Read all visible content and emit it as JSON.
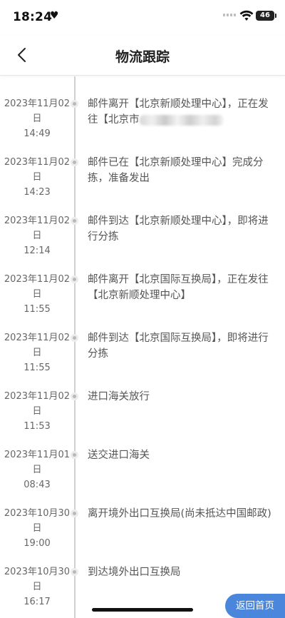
{
  "status_bar": {
    "time": "18:24",
    "heart_icon": "♥",
    "battery_level": "46",
    "signal_bars": 4,
    "signal_active_bars": 0
  },
  "nav": {
    "title": "物流跟踪",
    "back_icon": "chevron-left-icon"
  },
  "events": [
    {
      "date": "2023年11月02日",
      "time": "14:49",
      "desc_before_mask": "邮件离开【北京新顺处理中心】，正在发往【北京市",
      "has_mask": true
    },
    {
      "date": "2023年11月02日",
      "time": "14:23",
      "desc": "邮件已在【北京新顺处理中心】完成分拣，准备发出"
    },
    {
      "date": "2023年11月02日",
      "time": "12:14",
      "desc": "邮件到达【北京新顺处理中心】，即将进行分拣"
    },
    {
      "date": "2023年11月02日",
      "time": "11:55",
      "desc": "邮件离开【北京国际互换局】，正在发往【北京新顺处理中心】"
    },
    {
      "date": "2023年11月02日",
      "time": "11:55",
      "desc": "邮件到达【北京国际互换局】，即将进行分拣"
    },
    {
      "date": "2023年11月02日",
      "time": "11:53",
      "desc": "进口海关放行"
    },
    {
      "date": "2023年11月01日",
      "time": "08:43",
      "desc": "送交进口海关"
    },
    {
      "date": "2023年10月30日",
      "time": "19:00",
      "desc": "离开境外出口互换局(尚未抵达中国邮政)"
    },
    {
      "date": "2023年10月30日",
      "time": "16:17",
      "desc": "到达境外出口互换局"
    }
  ],
  "return_button": {
    "label": "返回首页"
  }
}
